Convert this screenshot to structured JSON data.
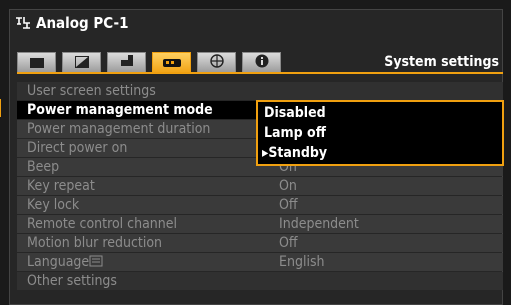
{
  "source": {
    "label": "Analog PC-1",
    "icon": "pc-input-icon"
  },
  "tabs": [
    {
      "name": "tab-image",
      "icon": "screen-icon",
      "active": false
    },
    {
      "name": "tab-image-adjust",
      "icon": "image-adjust-icon",
      "active": false
    },
    {
      "name": "tab-install",
      "icon": "projector-icon",
      "active": false
    },
    {
      "name": "tab-system",
      "icon": "system-icon",
      "active": true
    },
    {
      "name": "tab-network",
      "icon": "globe-icon",
      "active": false
    },
    {
      "name": "tab-info",
      "icon": "info-icon",
      "active": false
    }
  ],
  "menu_title": "System settings",
  "rows": [
    {
      "label": "User screen settings",
      "value": ""
    },
    {
      "label": "Power management mode",
      "value": ""
    },
    {
      "label": "Power management duration",
      "value": ""
    },
    {
      "label": "Direct power on",
      "value": ""
    },
    {
      "label": "Beep",
      "value": "On"
    },
    {
      "label": "Key repeat",
      "value": "On"
    },
    {
      "label": "Key lock",
      "value": "Off"
    },
    {
      "label": "Remote control channel",
      "value": "Independent"
    },
    {
      "label": "Motion blur reduction",
      "value": "Off"
    },
    {
      "label": "Language",
      "value": "English"
    },
    {
      "label": "Other settings",
      "value": ""
    }
  ],
  "dropdown": {
    "options": [
      "Disabled",
      "Lamp off",
      "Standby"
    ],
    "current_marker": "▸",
    "current": "Standby"
  },
  "colors": {
    "accent": "#f0a010",
    "row_bg": "#3a3a3a",
    "text_dim": "#8c8c8c"
  }
}
